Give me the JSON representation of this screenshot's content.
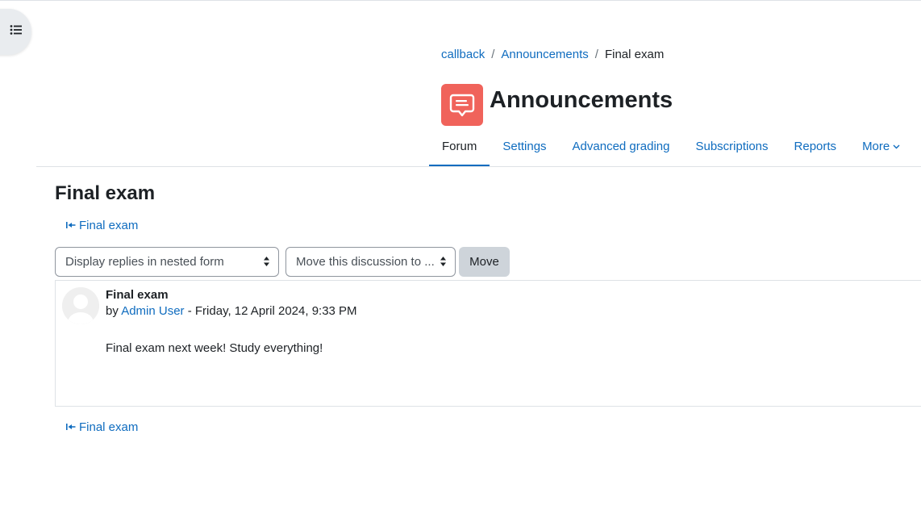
{
  "breadcrumb": {
    "items": [
      {
        "label": "callback"
      },
      {
        "label": "Announcements"
      }
    ],
    "current": "Final exam",
    "separator": "/"
  },
  "activity": {
    "title": "Announcements",
    "icon": "forum-speech-bubble-icon",
    "icon_color": "#f0635b"
  },
  "secondary_nav": {
    "tabs": [
      {
        "label": "Forum",
        "active": true
      },
      {
        "label": "Settings"
      },
      {
        "label": "Advanced grading"
      },
      {
        "label": "Subscriptions"
      },
      {
        "label": "Reports"
      },
      {
        "label": "More"
      }
    ]
  },
  "discussion": {
    "title": "Final exam",
    "nav_link_top": "Final exam",
    "nav_link_bottom": "Final exam"
  },
  "controls": {
    "display_mode_selected": "Display replies in nested form",
    "move_select_selected": "Move this discussion to ...",
    "move_button": "Move"
  },
  "post": {
    "subject": "Final exam",
    "by_prefix": "by",
    "author": "Admin User",
    "date_separator": " - ",
    "date": "Friday, 12 April 2024, 9:33 PM",
    "message": "Final exam next week! Study everything!"
  },
  "colors": {
    "link": "#0f6cbf",
    "text": "#1d2125",
    "border": "#dee2e6",
    "button_secondary": "#ced4da"
  }
}
